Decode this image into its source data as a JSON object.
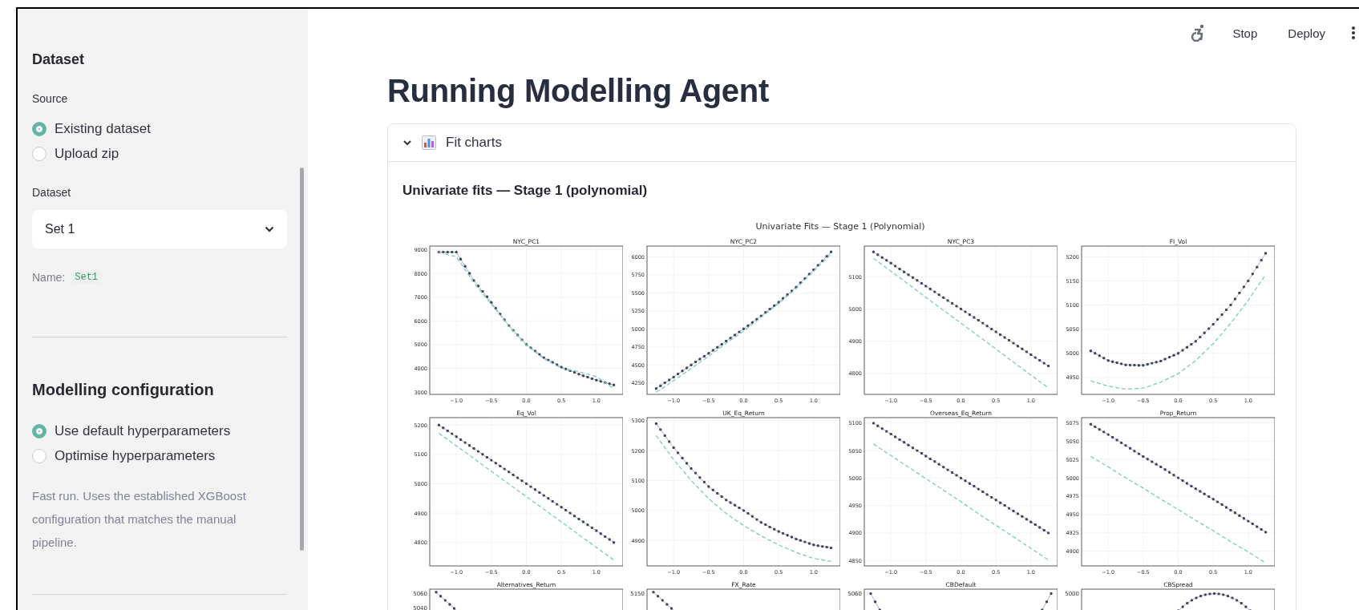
{
  "header": {
    "buttons": [
      "Stop",
      "Deploy"
    ]
  },
  "sidebar": {
    "dataset_heading": "Dataset",
    "source_label": "Source",
    "source_options": [
      {
        "label": "Existing dataset",
        "selected": true
      },
      {
        "label": "Upload zip",
        "selected": false
      }
    ],
    "dataset_label": "Dataset",
    "dataset_select": {
      "value": "Set 1"
    },
    "name_label": "Name:",
    "name_value": "Set1",
    "config_heading": "Modelling configuration",
    "config_options": [
      {
        "label": "Use default hyperparameters",
        "selected": true
      },
      {
        "label": "Optimise hyperparameters",
        "selected": false
      }
    ],
    "config_note": "Fast run. Uses the established XGBoost configuration that matches the manual pipeline."
  },
  "main": {
    "title": "Running Modelling Agent",
    "expander": {
      "label": "Fit charts",
      "expanded": true
    },
    "section_heading": "Univariate fits — Stage 1 (polynomial)",
    "figure": {
      "title": "Univariate Fits — Stage 1 (Polynomial)",
      "charts": [
        {
          "chart_data": {
            "type": "line",
            "title": "NYC_PC1",
            "grid": true,
            "x": [
              -1.25,
              -1,
              -0.75,
              -0.5,
              -0.25,
              0,
              0.25,
              0.5,
              0.75,
              1,
              1.25
            ],
            "xlim": [
              -1.38,
              1.38
            ],
            "ylim": [
              2900,
              9150
            ],
            "xticks": [
              {
                "value": -1,
                "label": "−1.0"
              },
              {
                "value": -0.5,
                "label": "−0.5"
              },
              {
                "value": 0,
                "label": "0.0"
              },
              {
                "value": 0.5,
                "label": "0.5"
              },
              {
                "value": 1,
                "label": "1.0"
              }
            ],
            "yticks": [
              3000,
              4000,
              5000,
              6000,
              7000,
              8000,
              9000
            ],
            "series": [
              {
                "color": "#3f4660",
                "line_style": "solid",
                "values": [
                  8900,
                  8900,
                  7700,
                  6780,
                  5800,
                  5000,
                  4450,
                  4050,
                  3750,
                  3500,
                  3300
                ]
              },
              {
                "color": "#7ecbb8",
                "line_style": "dashed",
                "values": [
                  8900,
                  8700,
                  7600,
                  6700,
                  5780,
                  4980,
                  4400,
                  4000,
                  3860,
                  3650,
                  3150
                ]
              }
            ]
          }
        },
        {
          "chart_data": {
            "type": "line",
            "title": "NYC_PC2",
            "grid": true,
            "x": [
              -1.25,
              -1,
              -0.75,
              -0.5,
              -0.25,
              0,
              0.25,
              0.5,
              0.75,
              1,
              1.25
            ],
            "xlim": [
              -1.38,
              1.38
            ],
            "ylim": [
              4090,
              6150
            ],
            "xticks": [
              {
                "value": -1,
                "label": "−1.0"
              },
              {
                "value": -0.5,
                "label": "−0.5"
              },
              {
                "value": 0,
                "label": "0.0"
              },
              {
                "value": 0.5,
                "label": "0.5"
              },
              {
                "value": 1,
                "label": "1.0"
              }
            ],
            "yticks": [
              4250,
              4500,
              4750,
              5000,
              5250,
              5500,
              5750,
              6000
            ],
            "series": [
              {
                "color": "#3f4660",
                "line_style": "solid",
                "values": [
                  4170,
                  4330,
                  4500,
                  4660,
                  4830,
                  5000,
                  5180,
                  5370,
                  5580,
                  5820,
                  6070
                ]
              },
              {
                "color": "#7ecbb8",
                "line_style": "dashed",
                "values": [
                  4120,
                  4280,
                  4450,
                  4620,
                  4800,
                  4970,
                  5160,
                  5350,
                  5560,
                  5800,
                  6040
                ]
              }
            ]
          }
        },
        {
          "chart_data": {
            "type": "line",
            "title": "NYC_PC3",
            "grid": true,
            "x": [
              -1.25,
              -1,
              -0.75,
              -0.5,
              -0.25,
              0,
              0.25,
              0.5,
              0.75,
              1,
              1.25
            ],
            "xlim": [
              -1.38,
              1.38
            ],
            "ylim": [
              4735,
              5195
            ],
            "xticks": [
              {
                "value": -1,
                "label": "−1.0"
              },
              {
                "value": -0.5,
                "label": "−0.5"
              },
              {
                "value": 0,
                "label": "0.0"
              },
              {
                "value": 0.5,
                "label": "0.5"
              },
              {
                "value": 1,
                "label": "1.0"
              }
            ],
            "yticks": [
              4800,
              4900,
              5000,
              5100
            ],
            "series": [
              {
                "color": "#3f4660",
                "line_style": "solid",
                "values": [
                  5177,
                  5142,
                  5106,
                  5071,
                  5035,
                  5000,
                  4965,
                  4929,
                  4894,
                  4858,
                  4823
                ]
              },
              {
                "color": "#7ecbb8",
                "line_style": "dashed",
                "values": [
                  5157,
                  5117,
                  5077,
                  5036,
                  4996,
                  4956,
                  4916,
                  4876,
                  4835,
                  4795,
                  4755
                ]
              }
            ]
          }
        },
        {
          "chart_data": {
            "type": "line",
            "title": "FI_Vol",
            "grid": true,
            "x": [
              -1.25,
              -1,
              -0.75,
              -0.5,
              -0.25,
              0,
              0.25,
              0.5,
              0.75,
              1,
              1.25
            ],
            "xlim": [
              -1.38,
              1.38
            ],
            "ylim": [
              4915,
              5222
            ],
            "xticks": [
              {
                "value": -1,
                "label": "−1.0"
              },
              {
                "value": -0.5,
                "label": "−0.5"
              },
              {
                "value": 0,
                "label": "0.0"
              },
              {
                "value": 0.5,
                "label": "0.5"
              },
              {
                "value": 1,
                "label": "1.0"
              }
            ],
            "yticks": [
              4950,
              5000,
              5050,
              5100,
              5150,
              5200
            ],
            "series": [
              {
                "color": "#3f4660",
                "line_style": "solid",
                "values": [
                  5005,
                  4985,
                  4976,
                  4975,
                  4984,
                  5000,
                  5025,
                  5060,
                  5100,
                  5150,
                  5207
                ]
              },
              {
                "color": "#7ecbb8",
                "line_style": "dashed",
                "values": [
                  4943,
                  4932,
                  4926,
                  4928,
                  4940,
                  4958,
                  4985,
                  5020,
                  5062,
                  5110,
                  5163
                ]
              }
            ]
          }
        },
        {
          "chart_data": {
            "type": "line",
            "title": "Eq_Vol",
            "grid": true,
            "x": [
              -1.25,
              -1,
              -0.75,
              -0.5,
              -0.25,
              0,
              0.25,
              0.5,
              0.75,
              1,
              1.25
            ],
            "xlim": [
              -1.38,
              1.38
            ],
            "ylim": [
              4720,
              5225
            ],
            "xticks": [
              {
                "value": -1,
                "label": "−1.0"
              },
              {
                "value": -0.5,
                "label": "−0.5"
              },
              {
                "value": 0,
                "label": "0.0"
              },
              {
                "value": 0.5,
                "label": "0.5"
              },
              {
                "value": 1,
                "label": "1.0"
              }
            ],
            "yticks": [
              4800,
              4900,
              5000,
              5100,
              5200
            ],
            "series": [
              {
                "color": "#3f4660",
                "line_style": "solid",
                "values": [
                  5200,
                  5160,
                  5120,
                  5080,
                  5040,
                  5000,
                  4960,
                  4920,
                  4880,
                  4840,
                  4800
                ]
              },
              {
                "color": "#7ecbb8",
                "line_style": "dashed",
                "values": [
                  5172,
                  5129,
                  5086,
                  5042,
                  4999,
                  4956,
                  4913,
                  4870,
                  4826,
                  4783,
                  4740
                ]
              }
            ]
          }
        },
        {
          "chart_data": {
            "type": "line",
            "title": "UK_Eq_Return",
            "grid": true,
            "x": [
              -1.25,
              -1,
              -0.75,
              -0.5,
              -0.25,
              0,
              0.25,
              0.5,
              0.75,
              1,
              1.25
            ],
            "xlim": [
              -1.38,
              1.38
            ],
            "ylim": [
              4815,
              5310
            ],
            "xticks": [
              {
                "value": -1,
                "label": "−1.0"
              },
              {
                "value": -0.5,
                "label": "−0.5"
              },
              {
                "value": 0,
                "label": "0.0"
              },
              {
                "value": 0.5,
                "label": "0.5"
              },
              {
                "value": 1,
                "label": "1.0"
              }
            ],
            "yticks": [
              4900,
              5000,
              5100,
              5200,
              5300
            ],
            "series": [
              {
                "color": "#3f4660",
                "line_style": "solid",
                "values": [
                  5290,
                  5210,
                  5140,
                  5080,
                  5035,
                  5000,
                  4960,
                  4930,
                  4905,
                  4885,
                  4875
                ]
              },
              {
                "color": "#7ecbb8",
                "line_style": "dashed",
                "values": [
                  5250,
                  5170,
                  5100,
                  5040,
                  4990,
                  4950,
                  4915,
                  4885,
                  4860,
                  4840,
                  4830
                ]
              }
            ]
          }
        },
        {
          "chart_data": {
            "type": "line",
            "title": "Overseas_Eq_Return",
            "grid": true,
            "x": [
              -1.25,
              -1,
              -0.75,
              -0.5,
              -0.25,
              0,
              0.25,
              0.5,
              0.75,
              1,
              1.25
            ],
            "xlim": [
              -1.38,
              1.38
            ],
            "ylim": [
              4840,
              5110
            ],
            "xticks": [
              {
                "value": -1,
                "label": "−1.0"
              },
              {
                "value": -0.5,
                "label": "−0.5"
              },
              {
                "value": 0,
                "label": "0.0"
              },
              {
                "value": 0.5,
                "label": "0.5"
              },
              {
                "value": 1,
                "label": "1.0"
              }
            ],
            "yticks": [
              4850,
              4900,
              4950,
              5000,
              5050,
              5100
            ],
            "series": [
              {
                "color": "#3f4660",
                "line_style": "solid",
                "values": [
                  5100,
                  5080,
                  5060,
                  5040,
                  5020,
                  5000,
                  4980,
                  4960,
                  4940,
                  4920,
                  4900
                ]
              },
              {
                "color": "#7ecbb8",
                "line_style": "dashed",
                "values": [
                  5062,
                  5041,
                  5020,
                  4999,
                  4978,
                  4957,
                  4935,
                  4914,
                  4893,
                  4872,
                  4851
                ]
              }
            ]
          }
        },
        {
          "chart_data": {
            "type": "line",
            "title": "Prop_Return",
            "grid": true,
            "x": [
              -1.25,
              -1,
              -0.75,
              -0.5,
              -0.25,
              0,
              0.25,
              0.5,
              0.75,
              1,
              1.25
            ],
            "xlim": [
              -1.38,
              1.38
            ],
            "ylim": [
              4880,
              5082
            ],
            "xticks": [
              {
                "value": -1,
                "label": "−1.0"
              },
              {
                "value": -0.5,
                "label": "−0.5"
              },
              {
                "value": 0,
                "label": "0.0"
              },
              {
                "value": 0.5,
                "label": "0.5"
              },
              {
                "value": 1,
                "label": "1.0"
              }
            ],
            "yticks": [
              4900,
              4925,
              4950,
              4975,
              5000,
              5025,
              5050,
              5075
            ],
            "series": [
              {
                "color": "#3f4660",
                "line_style": "solid",
                "values": [
                  5073,
                  5059,
                  5044,
                  5029,
                  5015,
                  5000,
                  4985,
                  4971,
                  4956,
                  4941,
                  4926
                ]
              },
              {
                "color": "#7ecbb8",
                "line_style": "dashed",
                "values": [
                  5029,
                  5015,
                  5000,
                  4986,
                  4971,
                  4957,
                  4942,
                  4928,
                  4913,
                  4899,
                  4884
                ]
              }
            ]
          }
        }
      ],
      "partial_panels": [
        {
          "title": "Alternatives_Return",
          "y_axis_labels": [
            {
              "label": "5060"
            },
            {
              "label": "5040"
            }
          ],
          "kind": "falling"
        },
        {
          "title": "FX_Rate",
          "y_axis_labels": [
            {
              "label": "5150"
            }
          ],
          "kind": "falling"
        },
        {
          "title": "CBDefault",
          "y_axis_labels": [
            {
              "label": "5060"
            }
          ],
          "kind": "u"
        },
        {
          "title": "CBSpread",
          "y_axis_labels": [
            {
              "label": "5000"
            }
          ],
          "kind": "arch"
        }
      ]
    }
  }
}
